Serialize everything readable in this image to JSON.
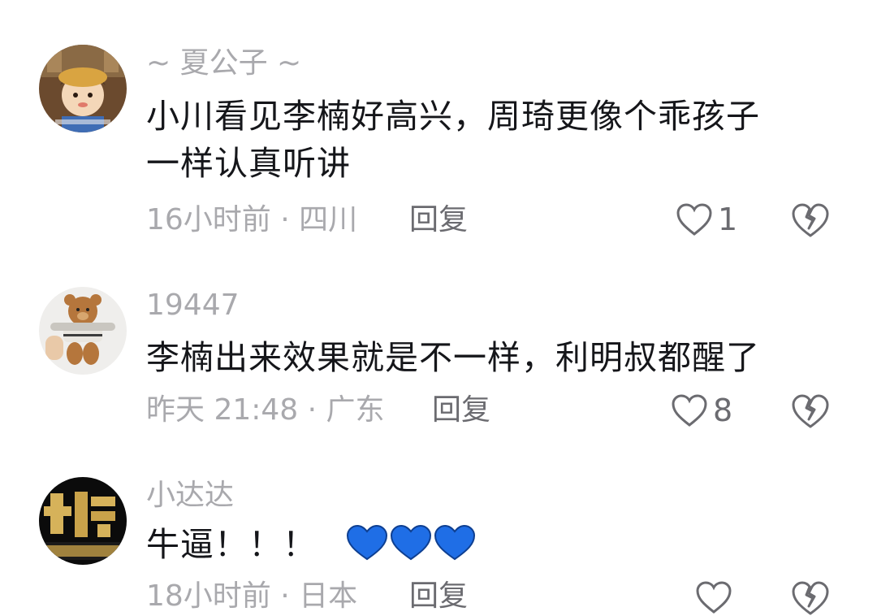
{
  "comments": [
    {
      "username": "~ 夏公子 ~",
      "text_line1": "小川看见李楠好高兴，周琦更像个乖孩子",
      "text_line2": "一样认真听讲",
      "meta": "16小时前 · 四川",
      "reply_label": "回复",
      "likes": "1",
      "avatar": "cartoon-boy-avatar"
    },
    {
      "username": "19447",
      "text_line1": "李楠出来效果就是不一样，利明叔都醒了",
      "meta": "昨天 21:48 · 广东",
      "reply_label": "回复",
      "likes": "8",
      "avatar": "teddy-bear-avatar"
    },
    {
      "username": "小达达",
      "text_line1": "牛逼！！！",
      "emoji": "💙💙💙",
      "meta": "18小时前 · 日本",
      "reply_label": "回复",
      "avatar": "gold-logo-avatar"
    }
  ],
  "colors": {
    "text": "#15161a",
    "muted": "#a9a9ad",
    "action": "#6b6b70",
    "blue_heart": "#1f6ee6"
  }
}
